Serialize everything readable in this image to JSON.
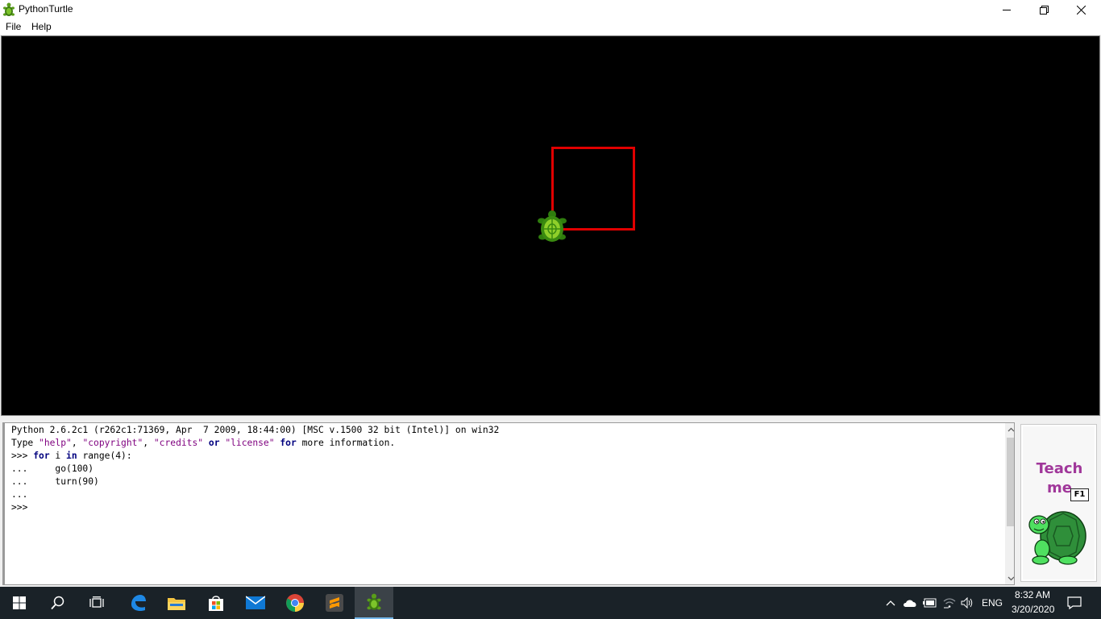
{
  "window": {
    "title": "PythonTurtle",
    "icon": "turtle-app-icon"
  },
  "window_controls": [
    "minimize-icon",
    "restore-icon",
    "close-icon"
  ],
  "menu": {
    "file": "File",
    "help": "Help"
  },
  "canvas": {
    "background": "#000000",
    "pen_color": "#e00000",
    "drawing": "square"
  },
  "shell": {
    "line1": "Python 2.6.2c1 (r262c1:71369, Apr  7 2009, 18:44:00) [MSC v.1500 32 bit (Intel)] on win32",
    "line2_prefix": "Type ",
    "line2_help": "\"help\"",
    "line2_sep1": ", ",
    "line2_copyright": "\"copyright\"",
    "line2_sep2": ", ",
    "line2_credits": "\"credits\"",
    "line2_or": "or",
    "line2_license": "\"license\"",
    "line2_for": "for",
    "line2_suffix": " more information.",
    "prompt": ">>>",
    "cont": "...",
    "code_for": "for",
    "code_i": " i ",
    "code_in": "in",
    "code_rest": " range(4):",
    "code_go": "    go(100)",
    "code_turn": "    turn(90)"
  },
  "teach_me": {
    "line1": "Teach",
    "line2": "me",
    "key": "F1"
  },
  "taskbar": {
    "apps": [
      "windows-start-icon",
      "search-icon",
      "task-view-icon",
      "edge-icon",
      "file-explorer-icon",
      "store-icon",
      "mail-icon",
      "chrome-icon",
      "sublime-text-icon",
      "python-turtle-icon"
    ],
    "language": "ENG",
    "time": "8:32 AM",
    "date": "3/20/2020"
  }
}
